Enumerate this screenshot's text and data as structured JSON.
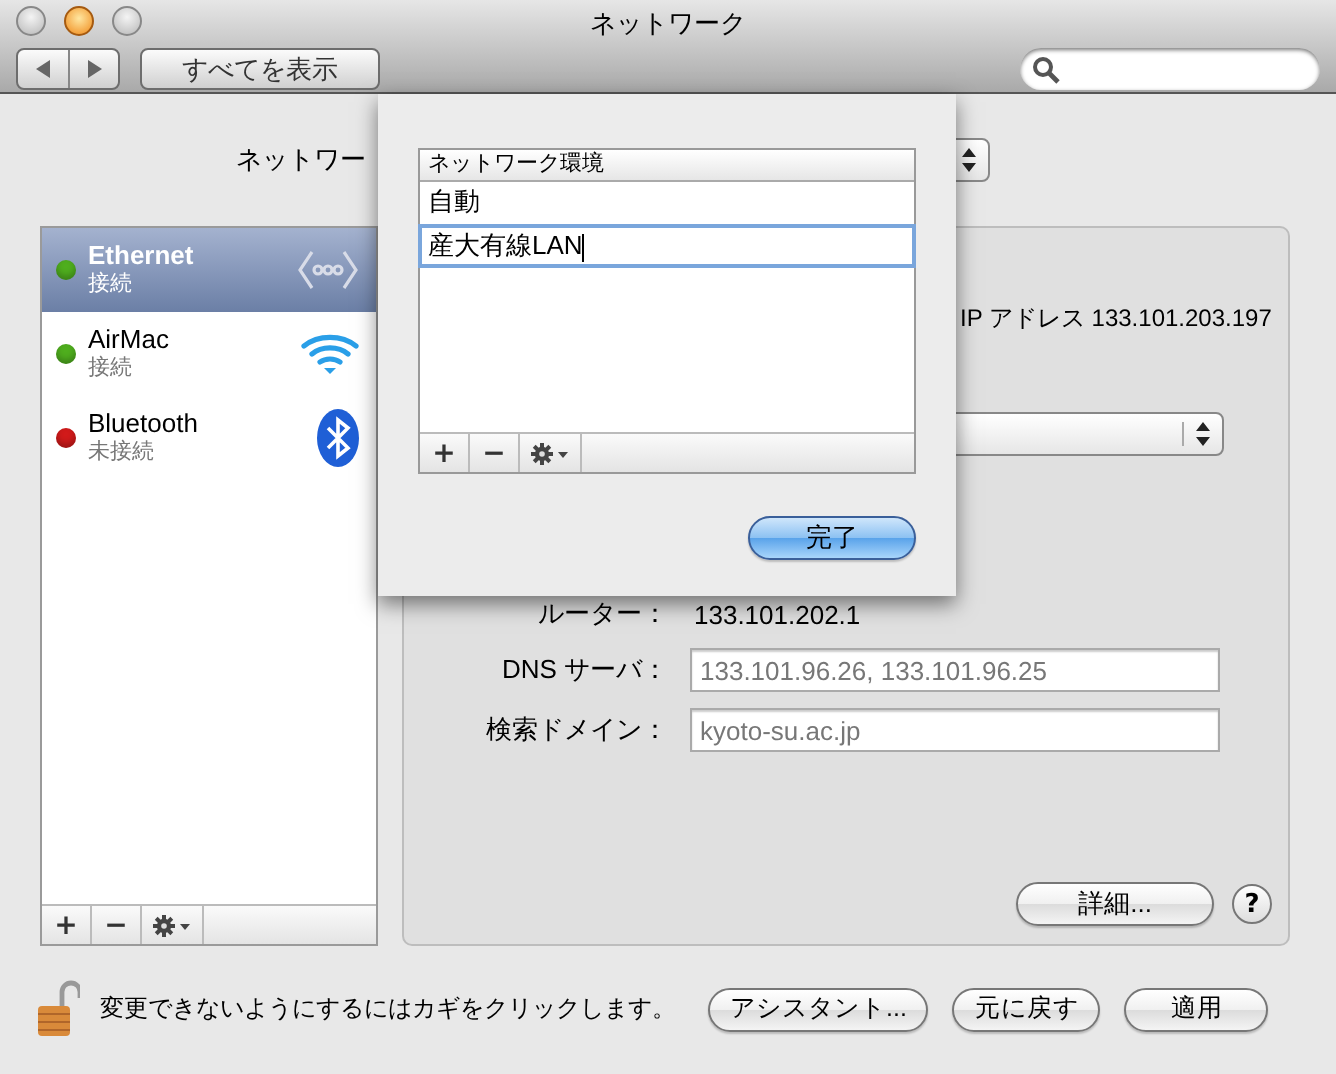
{
  "window": {
    "title": "ネットワーク"
  },
  "toolbar": {
    "show_all_button": "すべてを表示"
  },
  "location": {
    "label": "ネットワー"
  },
  "services": [
    {
      "name": "Ethernet",
      "status": "接続",
      "color": "#4fae1e",
      "selected": true,
      "kind": "ethernet"
    },
    {
      "name": "AirMac",
      "status": "接続",
      "color": "#4fae1e",
      "selected": false,
      "kind": "wifi"
    },
    {
      "name": "Bluetooth",
      "status": "未接続",
      "color": "#d11a1a",
      "selected": false,
      "kind": "bluetooth"
    }
  ],
  "service_buttons": [
    "+",
    "−"
  ],
  "detail": {
    "status": "IP アドレス 133.101.203.197",
    "fields": [
      {
        "label": "ルーター：",
        "value": "133.101.202.1",
        "kind": "text"
      },
      {
        "label": "DNS サーバ：",
        "value": "133.101.96.26, 133.101.96.25",
        "kind": "field"
      },
      {
        "label": "検索ドメイン：",
        "value": "kyoto-su.ac.jp",
        "kind": "field"
      }
    ],
    "advanced_button": "詳細...",
    "help": "?"
  },
  "footer": {
    "lock_text": "変更できないようにするにはカギをクリックします。",
    "buttons": [
      "アシスタント...",
      "元に戻す",
      "適用"
    ]
  },
  "sheet": {
    "column": "ネットワーク環境",
    "locations": [
      {
        "name": "自動",
        "selected": false
      },
      {
        "name": "産大有線LAN",
        "selected": true
      }
    ],
    "list_buttons": [
      "+",
      "−"
    ],
    "done_button": "完了"
  }
}
